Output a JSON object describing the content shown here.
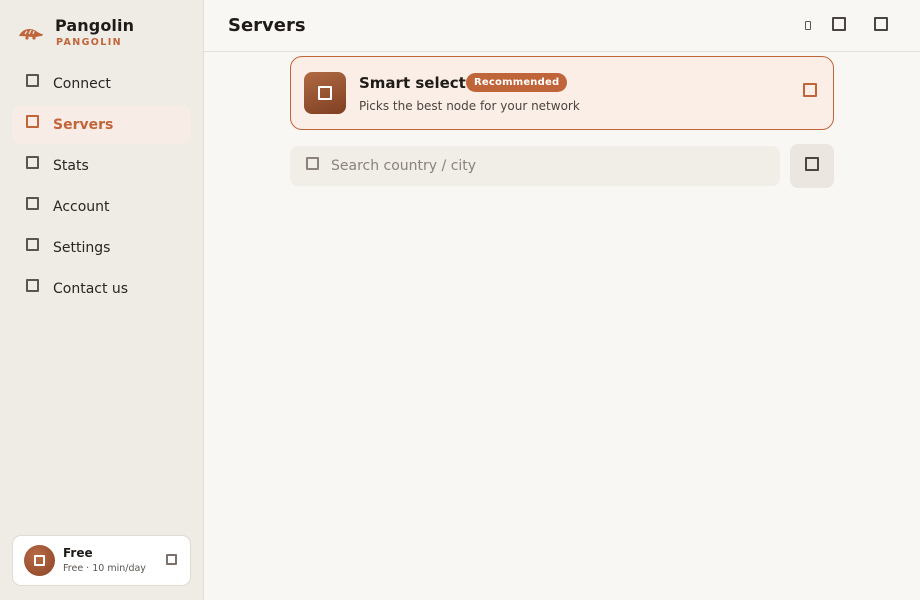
{
  "brand": {
    "name": "Pangolin",
    "subtitle": "PANGOLIN",
    "logo_icon": "pangolin-logo-icon",
    "accent": "#c0653a"
  },
  "sidebar": {
    "items": [
      {
        "label": "Connect",
        "icon": "connect-icon",
        "active": false
      },
      {
        "label": "Servers",
        "icon": "servers-icon",
        "active": true
      },
      {
        "label": "Stats",
        "icon": "stats-icon",
        "active": false
      },
      {
        "label": "Account",
        "icon": "account-icon",
        "active": false
      },
      {
        "label": "Settings",
        "icon": "settings-icon",
        "active": false
      },
      {
        "label": "Contact us",
        "icon": "contact-icon",
        "active": false
      }
    ],
    "plan": {
      "title": "Free",
      "description": "Free · 10 min/day"
    }
  },
  "header": {
    "title": "Servers"
  },
  "smart_select": {
    "title": "Smart select",
    "badge": "Recommended",
    "subtitle": "Picks the best node for your network"
  },
  "search": {
    "placeholder": "Search country / city",
    "value": ""
  }
}
